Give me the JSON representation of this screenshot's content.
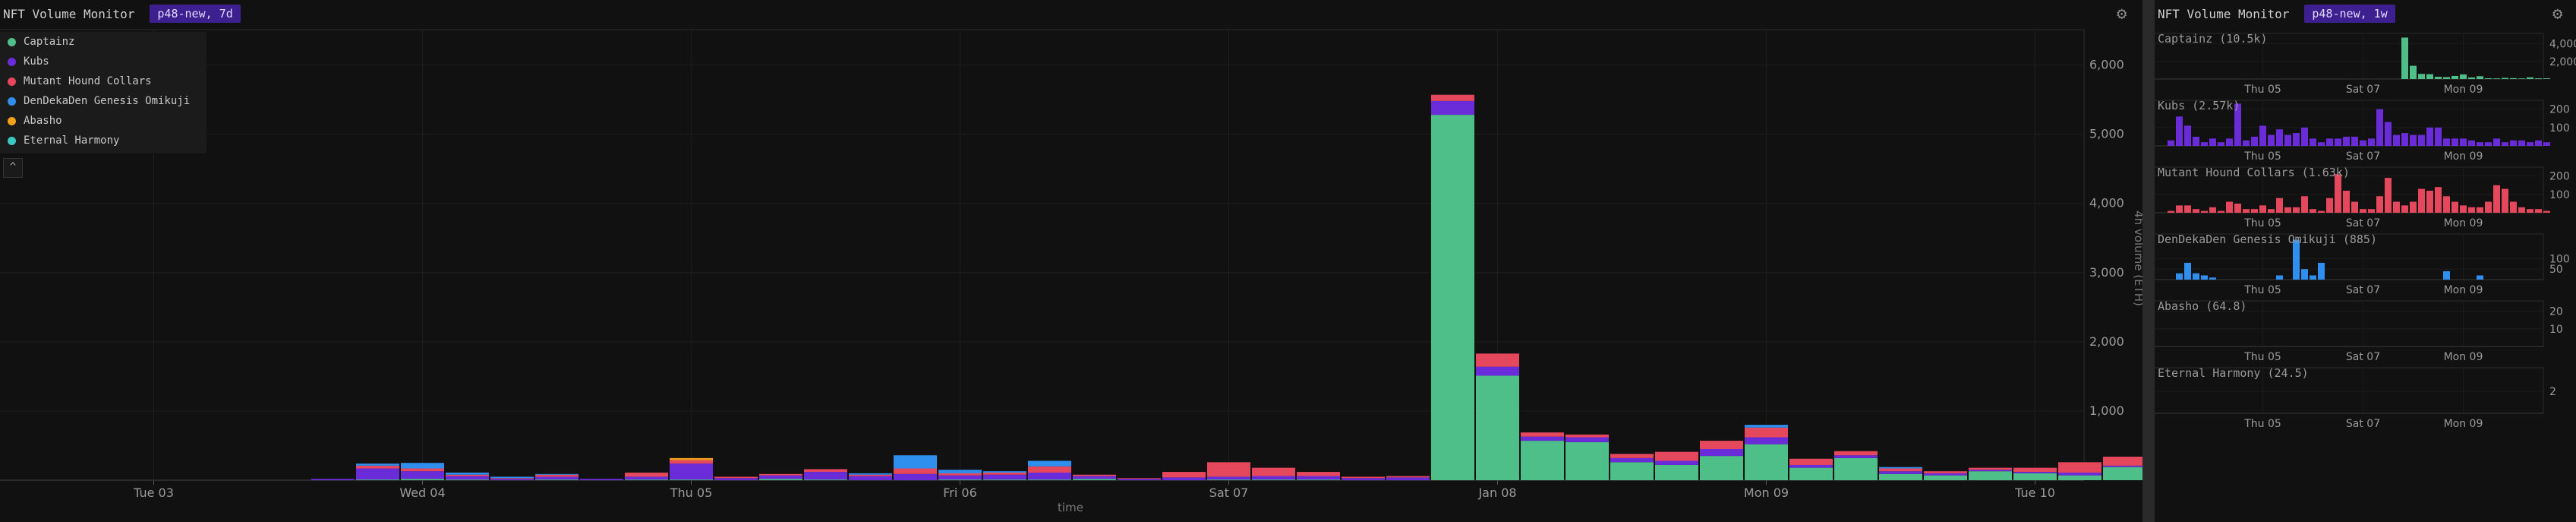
{
  "left": {
    "title": "NFT Volume Monitor",
    "tag": "p48-new, 7d",
    "gear": "gear-icon",
    "collapse_glyph": "^",
    "legend": [
      {
        "label": "Captainz",
        "color": "#4fbf8a"
      },
      {
        "label": "Kubs",
        "color": "#6a2bd9"
      },
      {
        "label": "Mutant Hound Collars",
        "color": "#e5475c"
      },
      {
        "label": "DenDekaDen Genesis Omikuji",
        "color": "#2f8fef"
      },
      {
        "label": "Abasho",
        "color": "#f5a01a"
      },
      {
        "label": "Eternal Harmony",
        "color": "#3cc7c0"
      }
    ]
  },
  "right": {
    "title": "NFT Volume Monitor",
    "tag": "p48-new, 1w",
    "gear": "gear-icon"
  },
  "chart_data": [
    {
      "type": "bar",
      "stacked": true,
      "xlabel": "time",
      "ylabel": "4h volume (ETH)",
      "ylim": [
        0,
        6500
      ],
      "yticks": [
        1000,
        2000,
        3000,
        4000,
        5000,
        6000
      ],
      "ytick_labels": [
        "1,000",
        "2,000",
        "3,000",
        "4,000",
        "5,000",
        "6,000"
      ],
      "x_tick_labels": [
        "Tue 03",
        "Wed 04",
        "Thu 05",
        "Fri 06",
        "Sat 07",
        "Jan 08",
        "Mon 09",
        "Tue 10"
      ],
      "x_tick_bins": [
        -1,
        5,
        11,
        17,
        23,
        29,
        35,
        41
      ],
      "series_order": [
        "Captainz",
        "Kubs",
        "Mutant Hound Collars",
        "DenDekaDen Genesis Omikuji",
        "Abasho",
        "Eternal Harmony"
      ],
      "bins": [
        [
          0,
          0,
          0,
          0,
          0,
          0
        ],
        [
          0,
          0,
          0,
          0,
          0,
          0
        ],
        [
          0,
          0,
          0,
          0,
          0,
          0
        ],
        [
          0,
          20,
          0,
          0,
          0,
          0
        ],
        [
          10,
          160,
          40,
          30,
          0,
          0
        ],
        [
          20,
          110,
          40,
          80,
          0,
          0
        ],
        [
          10,
          50,
          20,
          30,
          0,
          0
        ],
        [
          0,
          20,
          10,
          20,
          0,
          0
        ],
        [
          10,
          40,
          30,
          10,
          0,
          0
        ],
        [
          0,
          20,
          0,
          0,
          0,
          0
        ],
        [
          10,
          40,
          60,
          0,
          0,
          0
        ],
        [
          10,
          230,
          50,
          0,
          30,
          0
        ],
        [
          0,
          30,
          20,
          0,
          0,
          0
        ],
        [
          20,
          50,
          20,
          0,
          0,
          0
        ],
        [
          10,
          110,
          40,
          0,
          0,
          0
        ],
        [
          0,
          60,
          20,
          20,
          0,
          0
        ],
        [
          0,
          90,
          80,
          190,
          0,
          0
        ],
        [
          10,
          60,
          30,
          50,
          0,
          0
        ],
        [
          10,
          70,
          30,
          20,
          0,
          0
        ],
        [
          10,
          100,
          90,
          80,
          0,
          0
        ],
        [
          20,
          40,
          20,
          0,
          0,
          0
        ],
        [
          0,
          20,
          10,
          0,
          0,
          0
        ],
        [
          0,
          40,
          80,
          0,
          0,
          0
        ],
        [
          10,
          40,
          210,
          0,
          0,
          0
        ],
        [
          10,
          50,
          120,
          0,
          0,
          0
        ],
        [
          10,
          50,
          60,
          0,
          0,
          0
        ],
        [
          0,
          30,
          20,
          0,
          0,
          0
        ],
        [
          0,
          40,
          20,
          0,
          0,
          0
        ],
        [
          5280,
          200,
          90,
          0,
          0,
          0
        ],
        [
          1510,
          130,
          190,
          0,
          0,
          0
        ],
        [
          570,
          60,
          60,
          0,
          0,
          0
        ],
        [
          550,
          70,
          40,
          0,
          0,
          0
        ],
        [
          260,
          60,
          60,
          0,
          0,
          0
        ],
        [
          220,
          60,
          130,
          0,
          0,
          0
        ],
        [
          350,
          100,
          120,
          0,
          0,
          0
        ],
        [
          520,
          100,
          140,
          40,
          0,
          0
        ],
        [
          180,
          40,
          90,
          0,
          0,
          0
        ],
        [
          320,
          40,
          60,
          0,
          0,
          0
        ],
        [
          90,
          40,
          40,
          20,
          0,
          0
        ],
        [
          70,
          30,
          30,
          0,
          0,
          0
        ],
        [
          130,
          20,
          30,
          0,
          0,
          0
        ],
        [
          100,
          20,
          60,
          0,
          0,
          0
        ],
        [
          70,
          40,
          150,
          0,
          0,
          0
        ],
        [
          190,
          20,
          130,
          0,
          0,
          0
        ],
        [
          80,
          30,
          60,
          0,
          0,
          0
        ],
        [
          80,
          20,
          30,
          0,
          0,
          0
        ]
      ]
    },
    {
      "type": "bar",
      "title": "Captainz (10.5k)",
      "yticks": [
        2000,
        4000
      ],
      "ytick_labels": [
        "2,000",
        "4,000"
      ],
      "ylim": [
        0,
        5000
      ],
      "color": "#4fbf8a",
      "x_tick_labels": [
        "Thu 05",
        "Sat 07",
        "Mon 09"
      ],
      "x_tick_bins": [
        11,
        23,
        35
      ],
      "values": [
        0,
        0,
        0,
        0,
        0,
        0,
        0,
        0,
        0,
        0,
        0,
        0,
        0,
        0,
        0,
        0,
        0,
        0,
        0,
        0,
        0,
        0,
        0,
        0,
        0,
        0,
        0,
        0,
        4700,
        1500,
        580,
        550,
        260,
        220,
        350,
        520,
        180,
        320,
        90,
        70,
        130,
        100,
        70,
        190,
        80,
        80
      ]
    },
    {
      "type": "bar",
      "title": "Kubs (2.57k)",
      "yticks": [
        100,
        200
      ],
      "ytick_labels": [
        "100",
        "200"
      ],
      "ylim": [
        0,
        240
      ],
      "color": "#6a2bd9",
      "x_tick_labels": [
        "Thu 05",
        "Sat 07",
        "Mon 09"
      ],
      "x_tick_bins": [
        11,
        23,
        35
      ],
      "values": [
        30,
        160,
        110,
        50,
        20,
        40,
        20,
        40,
        230,
        30,
        50,
        110,
        60,
        90,
        60,
        70,
        100,
        40,
        20,
        40,
        40,
        50,
        50,
        30,
        40,
        200,
        130,
        60,
        70,
        60,
        60,
        100,
        100,
        40,
        40,
        40,
        30,
        20,
        20,
        40,
        20,
        30,
        30,
        20,
        30,
        20
      ]
    },
    {
      "type": "bar",
      "title": "Mutant Hound Collars (1.63k)",
      "yticks": [
        100,
        200
      ],
      "ytick_labels": [
        "100",
        "200"
      ],
      "ylim": [
        0,
        240
      ],
      "color": "#e5475c",
      "x_tick_labels": [
        "Thu 05",
        "Sat 07",
        "Mon 09"
      ],
      "x_tick_bins": [
        11,
        23,
        35
      ],
      "values": [
        10,
        40,
        40,
        20,
        10,
        30,
        10,
        60,
        50,
        20,
        20,
        40,
        20,
        80,
        30,
        30,
        90,
        20,
        10,
        80,
        210,
        120,
        60,
        20,
        20,
        90,
        190,
        60,
        40,
        60,
        130,
        120,
        140,
        90,
        60,
        40,
        30,
        30,
        60,
        150,
        130,
        60,
        30,
        20,
        20,
        10
      ]
    },
    {
      "type": "bar",
      "title": "DenDekaDen Genesis Omikuji (885)",
      "yticks": [
        50,
        100
      ],
      "ytick_labels": [
        "50",
        "100"
      ],
      "ylim": [
        0,
        210
      ],
      "color": "#2f8fef",
      "x_tick_labels": [
        "Thu 05",
        "Sat 07",
        "Mon 09"
      ],
      "x_tick_bins": [
        11,
        23,
        35
      ],
      "values": [
        0,
        30,
        80,
        30,
        20,
        10,
        0,
        0,
        0,
        0,
        0,
        0,
        0,
        20,
        0,
        190,
        50,
        20,
        80,
        0,
        0,
        0,
        0,
        0,
        0,
        0,
        0,
        0,
        0,
        0,
        0,
        0,
        0,
        40,
        0,
        0,
        0,
        20,
        0,
        0,
        0,
        0,
        0,
        0,
        0,
        0
      ]
    },
    {
      "type": "bar",
      "title": "Abasho (64.8)",
      "yticks": [
        10,
        20
      ],
      "ytick_labels": [
        "10",
        "20"
      ],
      "ylim": [
        0,
        25
      ],
      "color": "#f5a01a",
      "x_tick_labels": [
        "Thu 05",
        "Sat 07",
        "Mon 09"
      ],
      "x_tick_bins": [
        11,
        23,
        35
      ],
      "values": [
        0,
        0,
        0,
        0,
        0,
        0,
        0,
        0,
        0,
        0,
        0,
        0,
        0,
        0,
        0,
        0,
        0,
        0,
        0,
        0,
        0,
        0,
        0,
        0,
        0,
        0,
        0,
        0,
        0,
        0,
        0,
        0,
        0,
        0,
        0,
        0,
        0,
        0,
        0,
        0,
        0,
        0,
        0,
        0,
        0,
        0
      ]
    },
    {
      "type": "bar",
      "title": "Eternal Harmony (24.5)",
      "yticks": [
        2
      ],
      "ytick_labels": [
        "2"
      ],
      "ylim": [
        0,
        4
      ],
      "color": "#3cc7c0",
      "x_tick_labels": [
        "Thu 05",
        "Sat 07",
        "Mon 09"
      ],
      "x_tick_bins": [
        11,
        23,
        35
      ],
      "values": [
        0,
        0,
        0,
        0,
        0,
        0,
        0,
        0,
        0,
        0,
        0,
        0,
        0,
        0,
        0,
        0,
        0,
        0,
        0,
        0,
        0,
        0,
        0,
        0,
        0,
        0,
        0,
        0,
        0,
        0,
        0,
        0,
        0,
        0,
        0,
        0,
        0,
        0,
        0,
        0,
        0,
        0,
        0,
        0,
        0,
        0
      ]
    }
  ]
}
